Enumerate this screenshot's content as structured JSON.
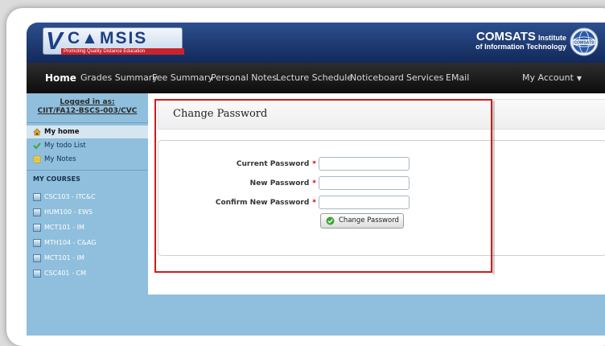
{
  "banner": {
    "logo_initial": "V",
    "logo_text": "C▲MSIS",
    "logo_tagline": "Promoting Quality Distance Education",
    "institute_name": "COMSATS",
    "institute_name_suffix": "Institute",
    "institute_subtitle": "of Information Technology",
    "seal_text": "COMSATS"
  },
  "nav": {
    "items": [
      {
        "label": "Home"
      },
      {
        "label": "Grades Summary"
      },
      {
        "label": "Fee Summary"
      },
      {
        "label": "Personal Notes"
      },
      {
        "label": "Lecture Schedule"
      },
      {
        "label": "Noticeboard"
      },
      {
        "label": "Services"
      },
      {
        "label": "EMail"
      }
    ],
    "account_label": "My Account",
    "account_caret": "▼"
  },
  "sidebar": {
    "logged_in_label": "Logged in as:",
    "user_id": "CIIT/FA12-BSCS-003/CVC",
    "links": [
      {
        "label": "My home"
      },
      {
        "label": "My todo List"
      },
      {
        "label": "My Notes"
      }
    ],
    "courses_heading": "MY COURSES",
    "courses": [
      {
        "label": "CSC103 - ITC&C"
      },
      {
        "label": "HUM100 - EWS"
      },
      {
        "label": "MCT101 - IM"
      },
      {
        "label": "MTH104 - C&AG"
      },
      {
        "label": "MCT101 - IM"
      },
      {
        "label": "CSC401 - CM"
      }
    ]
  },
  "main": {
    "title": "Change Password",
    "fields": [
      {
        "label": "Current Password",
        "required_mark": "*",
        "value": ""
      },
      {
        "label": "New Password",
        "required_mark": "*",
        "value": ""
      },
      {
        "label": "Confirm New Password",
        "required_mark": "*",
        "value": ""
      }
    ],
    "submit_label": "Change Password"
  },
  "colors": {
    "banner": "#1f3d78",
    "nav": "#1a1a1a",
    "sidebar": "#8fbfdc",
    "highlight": "#d31a1a",
    "required": "#d40000"
  }
}
